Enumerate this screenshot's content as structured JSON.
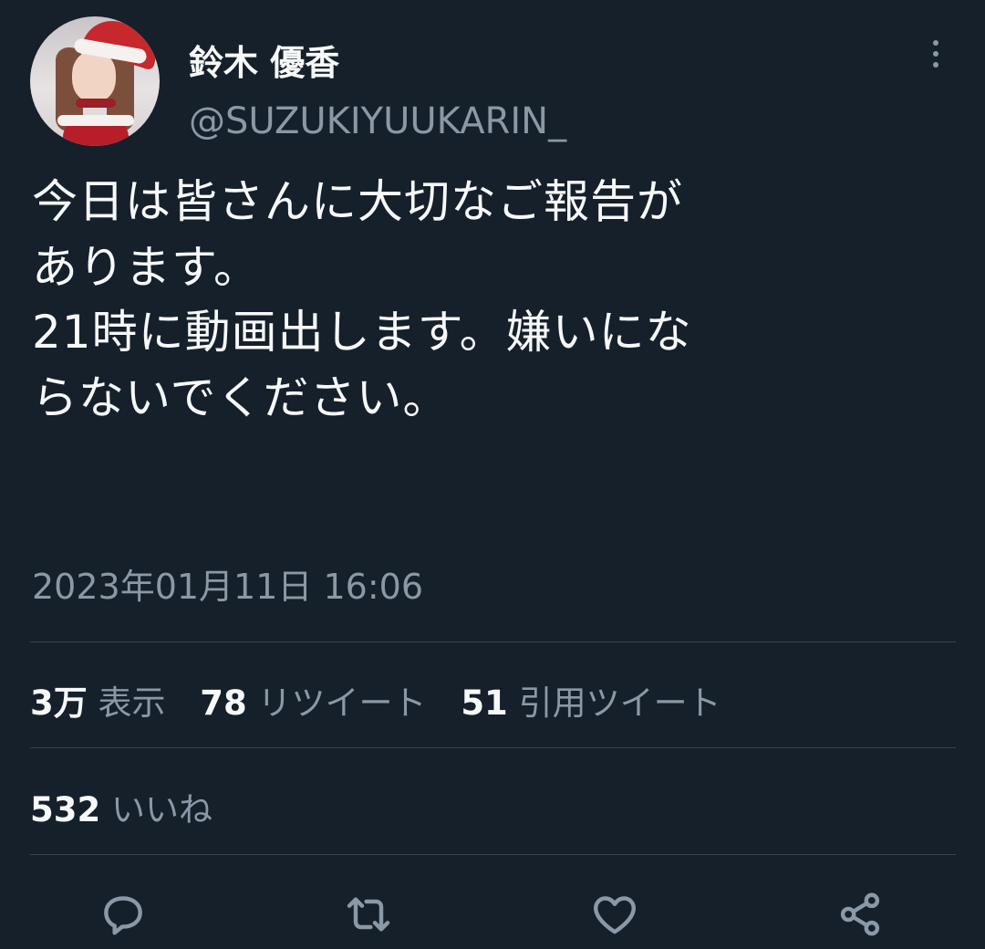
{
  "author": {
    "display_name": "鈴木 優香",
    "handle": "@SUZUKIYUUKARIN_"
  },
  "tweet": {
    "text": "今日は皆さんに大切なご報告が\nあります。\n21時に動画出します。嫌いにな\nらないでください。",
    "timestamp": "2023年01月11日 16:06"
  },
  "stats": {
    "views_count": "3万",
    "views_label": "表示",
    "retweets_count": "78",
    "retweets_label": "リツイート",
    "quotes_count": "51",
    "quotes_label": "引用ツイート",
    "likes_count": "532",
    "likes_label": "いいね"
  },
  "icons": {
    "more": "more-vertical-icon",
    "reply": "reply-icon",
    "retweet": "retweet-icon",
    "like": "heart-icon",
    "share": "share-icon"
  },
  "colors": {
    "background": "#15202b",
    "text": "#f7f9f9",
    "secondary": "#8b98a5",
    "divider": "#38444d"
  }
}
